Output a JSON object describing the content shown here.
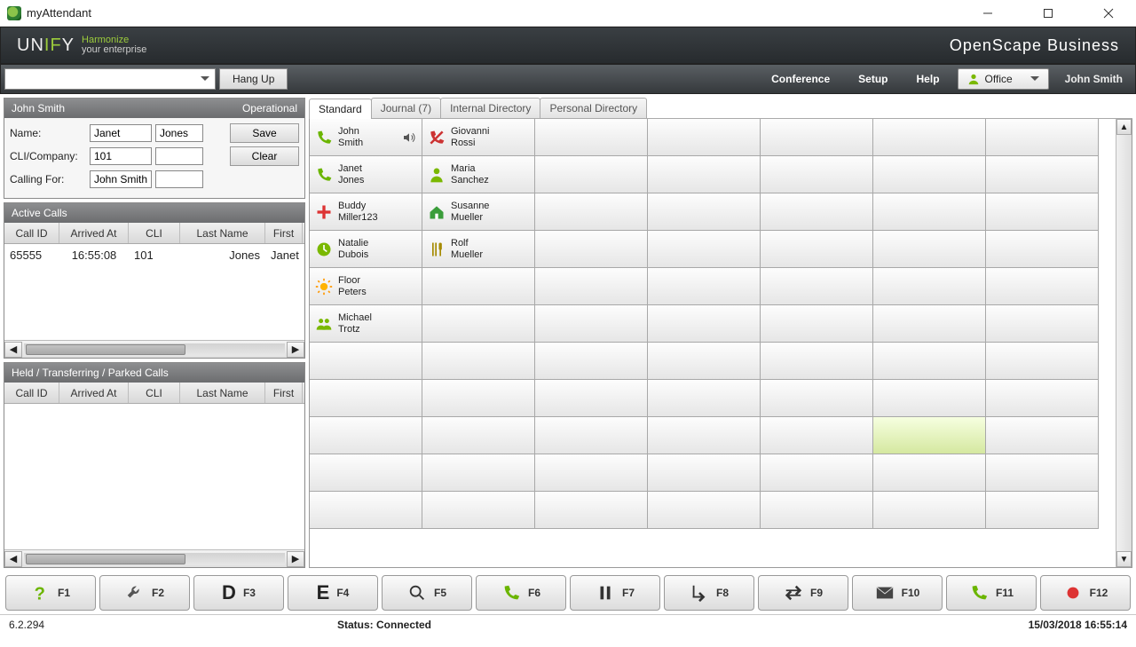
{
  "window": {
    "title": "myAttendant"
  },
  "brand": {
    "logo_pre": "UN",
    "logo_mid": "IF",
    "logo_post": "Y",
    "tag1": "Harmonize",
    "tag2": "your enterprise",
    "product": "OpenScape Business"
  },
  "toolbar": {
    "hangup": "Hang Up",
    "conference": "Conference",
    "setup": "Setup",
    "help": "Help",
    "status_label": "Office",
    "user": "John Smith"
  },
  "edit_panel": {
    "name": "John Smith",
    "state": "Operational",
    "labels": {
      "name": "Name:",
      "cli": "CLI/Company:",
      "calling_for": "Calling For:"
    },
    "first": "Janet",
    "last": "Jones",
    "cli": "101",
    "company": "",
    "calling_for": "John Smith",
    "save": "Save",
    "clear": "Clear"
  },
  "active": {
    "title": "Active Calls",
    "cols": {
      "id": "Call ID",
      "at": "Arrived At",
      "cli": "CLI",
      "ln": "Last Name",
      "fn": "First"
    },
    "rows": [
      {
        "id": "65555",
        "at": "16:55:08",
        "cli": "101",
        "ln": "Jones",
        "fn": "Janet"
      }
    ]
  },
  "held": {
    "title": "Held / Transferring / Parked Calls",
    "cols": {
      "id": "Call ID",
      "at": "Arrived At",
      "cli": "CLI",
      "ln": "Last Name",
      "fn": "First"
    }
  },
  "tabs": {
    "standard": "Standard",
    "journal": "Journal (7)",
    "internal": "Internal Directory",
    "personal": "Personal Directory"
  },
  "contacts": [
    [
      {
        "icon": "phone-green",
        "l1": "John",
        "l2": "Smith",
        "extra": "speaker"
      },
      {
        "icon": "phone-red",
        "l1": "Giovanni",
        "l2": "Rossi"
      }
    ],
    [
      {
        "icon": "phone-green",
        "l1": "Janet",
        "l2": "Jones"
      },
      {
        "icon": "person",
        "l1": "Maria",
        "l2": "Sanchez"
      }
    ],
    [
      {
        "icon": "plus",
        "l1": "Buddy",
        "l2": "Miller123"
      },
      {
        "icon": "house",
        "l1": "Susanne",
        "l2": "Mueller"
      }
    ],
    [
      {
        "icon": "clock",
        "l1": "Natalie",
        "l2": "Dubois"
      },
      {
        "icon": "fork",
        "l1": "Rolf",
        "l2": "Mueller"
      }
    ],
    [
      {
        "icon": "sun",
        "l1": "Floor",
        "l2": "Peters"
      }
    ],
    [
      {
        "icon": "people",
        "l1": "Michael",
        "l2": "Trotz"
      }
    ]
  ],
  "fkeys": {
    "f1": "F1",
    "f2": "F2",
    "f3": "F3",
    "f4": "F4",
    "f5": "F5",
    "f6": "F6",
    "f7": "F7",
    "f8": "F8",
    "f9": "F9",
    "f10": "F10",
    "f11": "F11",
    "f12": "F12",
    "d": "D",
    "e": "E"
  },
  "status": {
    "version": "6.2.294",
    "text": "Status: Connected",
    "datetime": "15/03/2018 16:55:14"
  }
}
